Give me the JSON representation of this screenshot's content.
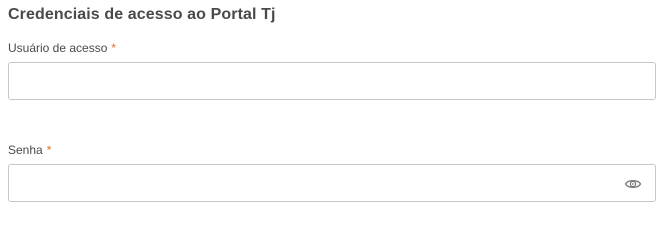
{
  "section": {
    "title": "Credenciais de acesso ao Portal Tj"
  },
  "fields": {
    "username": {
      "label": "Usuário de acesso",
      "required_mark": "*",
      "value": "",
      "placeholder": ""
    },
    "password": {
      "label": "Senha",
      "required_mark": "*",
      "value": "",
      "placeholder": "",
      "toggle_icon": "eye-icon"
    }
  },
  "colors": {
    "required": "#e0712c",
    "border": "#c8c8c8",
    "text": "#4a4a4a"
  }
}
